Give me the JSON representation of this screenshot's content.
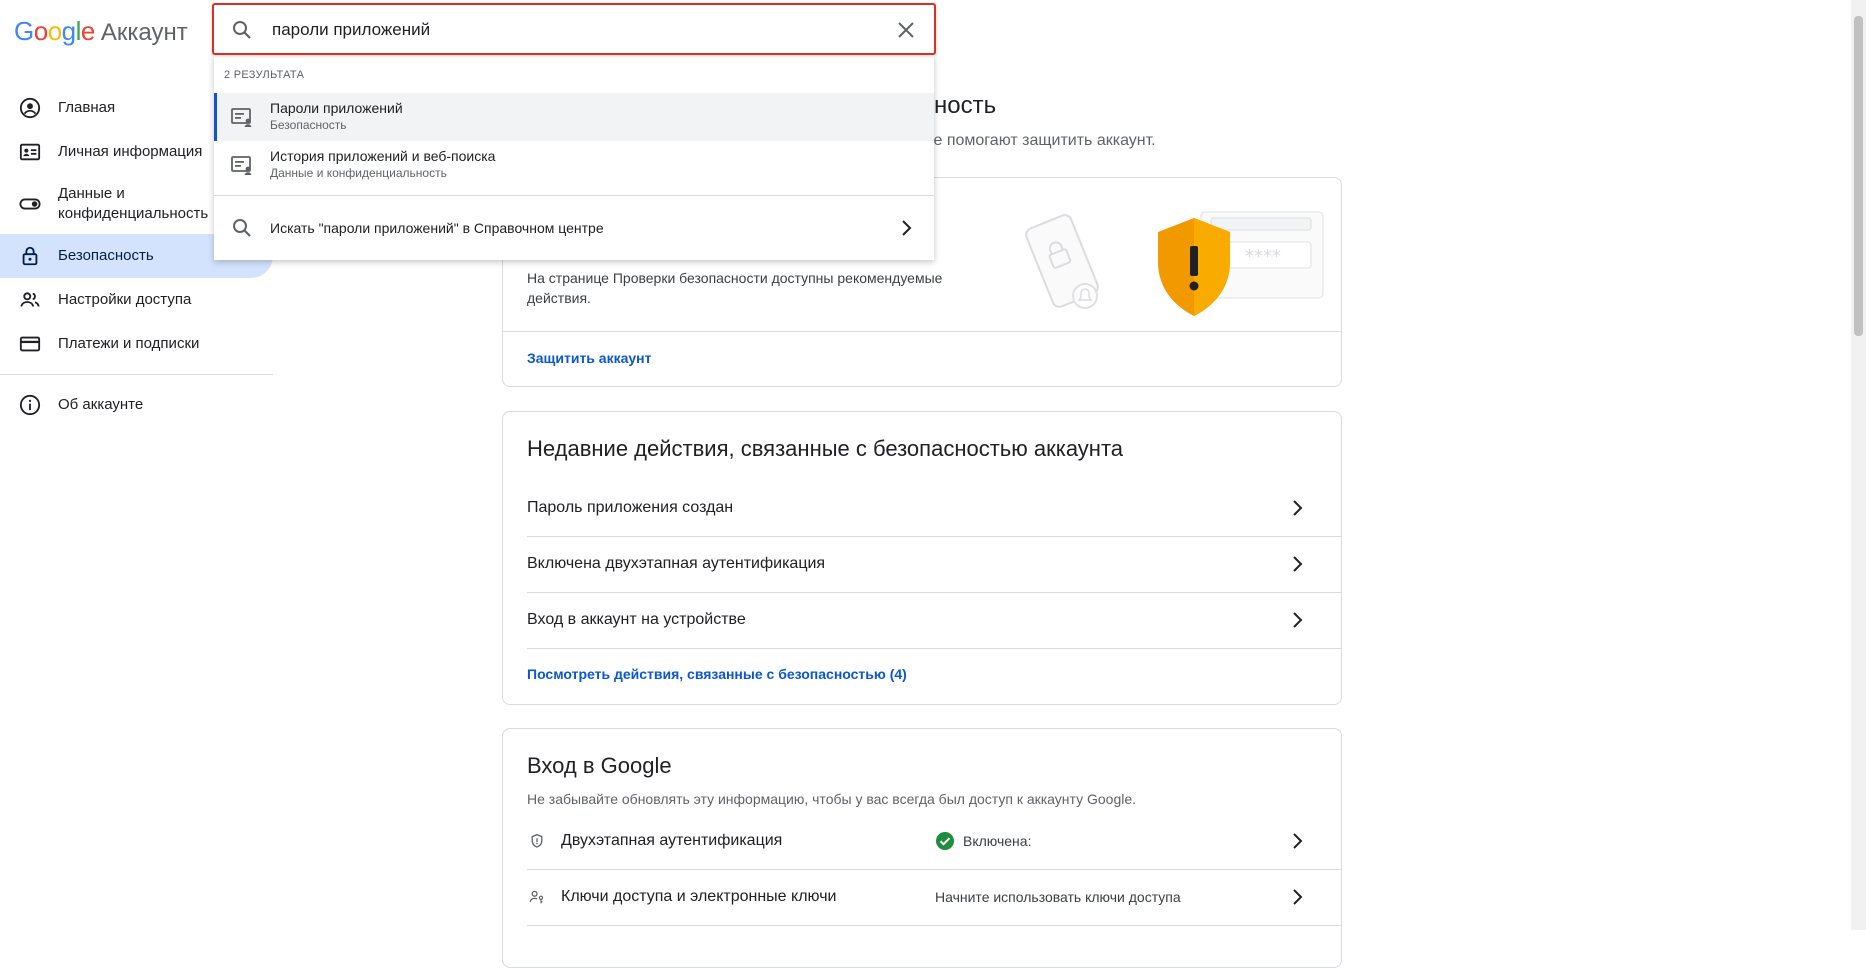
{
  "logo": {
    "google": "Google",
    "account": "Аккаунт"
  },
  "sidebar": {
    "items": [
      {
        "label": "Главная",
        "icon": "account-circle-icon"
      },
      {
        "label": "Личная информация",
        "icon": "id-card-icon"
      },
      {
        "label": "Данные и конфиденциальность",
        "icon": "toggle-icon"
      },
      {
        "label": "Безопасность",
        "icon": "lock-icon",
        "active": true
      },
      {
        "label": "Настройки доступа",
        "icon": "people-icon"
      },
      {
        "label": "Платежи и подписки",
        "icon": "credit-card-icon"
      }
    ],
    "about": {
      "label": "Об аккаунте",
      "icon": "info-icon"
    }
  },
  "page": {
    "title_visible": "сность",
    "subtitle_visible": "ые помогают защитить аккаунт."
  },
  "security_checkup": {
    "description": "На странице Проверки безопасности доступны рекомендуемые действия.",
    "link": "Защитить аккаунт"
  },
  "recent_activity": {
    "title": "Недавние действия, связанные с безопасностью аккаунта",
    "rows": [
      "Пароль приложения создан",
      "Включена двухэтапная аутентификация",
      "Вход в аккаунт на устройстве"
    ],
    "link": "Посмотреть действия, связанные с безопасностью (4)"
  },
  "signin": {
    "title": "Вход в Google",
    "subtitle": "Не забывайте обновлять эту информацию, чтобы у вас всегда был доступ к аккаунту Google.",
    "rows": [
      {
        "name": "Двухэтапная аутентификация",
        "value": "Включена:",
        "icon": "shield-icon",
        "status_icon": "check-circle-icon"
      },
      {
        "name": "Ключи доступа и электронные ключи",
        "value": "Начните использовать ключи доступа",
        "icon": "passkey-icon"
      }
    ]
  },
  "search": {
    "value": "пароли приложений",
    "results_count": "2 РЕЗУЛЬТАТА",
    "results": [
      {
        "title": "Пароли приложений",
        "section": "Безопасность"
      },
      {
        "title": "История приложений и веб-поиска",
        "section": "Данные и конфиденциальность"
      }
    ],
    "help_link": "Искать \"пароли приложений\" в Справочном центре"
  },
  "colors": {
    "accent": "#0b57d0",
    "active_nav": "#d3e3fd",
    "search_border": "#d93025",
    "success": "#1e8e3e",
    "shield": "#f9ab00"
  }
}
